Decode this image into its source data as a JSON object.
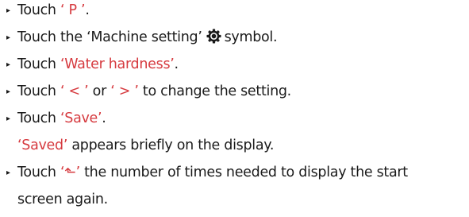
{
  "bullet_glyph": "▸",
  "accent_color": "#d63a3f",
  "text_color": "#1a1a1a",
  "steps": [
    {
      "pre": "Touch ",
      "highlight": "‘ P ’",
      "post": "."
    },
    {
      "pre": "Touch the ‘Machine setting’",
      "icon": "gear-icon",
      "post": "symbol."
    },
    {
      "pre": "Touch ",
      "highlight": "‘Water hardness’",
      "post": "."
    },
    {
      "pre": "Touch ",
      "highlight_a": "‘ < ’",
      "mid": " or ",
      "highlight_b": "‘ > ’",
      "post": " to change the setting."
    },
    {
      "pre": "Touch ",
      "highlight": "‘Save’",
      "post": "."
    }
  ],
  "note": {
    "highlight": "‘Saved’",
    "post": " appears briefly on the display."
  },
  "final_step": {
    "pre": "Touch ",
    "highlight": "‘⬑’",
    "post": " the number of times needed to display the start",
    "continuation": "screen again."
  }
}
